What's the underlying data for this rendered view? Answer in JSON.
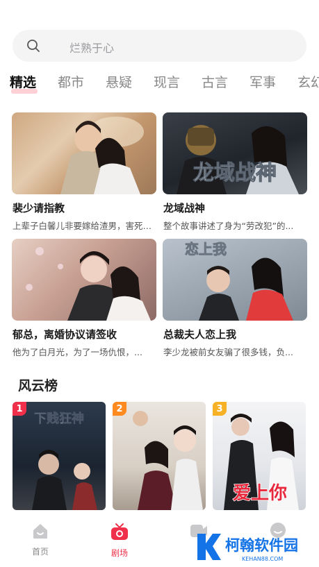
{
  "search": {
    "placeholder": "烂熟于心",
    "icon": "search-icon"
  },
  "tabs": [
    {
      "label": "精选",
      "active": true
    },
    {
      "label": "都市",
      "active": false
    },
    {
      "label": "悬疑",
      "active": false
    },
    {
      "label": "现言",
      "active": false
    },
    {
      "label": "古言",
      "active": false
    },
    {
      "label": "军事",
      "active": false
    },
    {
      "label": "玄幻",
      "active": false
    }
  ],
  "featured": [
    {
      "title": "裴少请指教",
      "desc": "上辈子白馨儿非要嫁给渣男，害死了..."
    },
    {
      "title": "龙域战神",
      "desc": "整个故事讲述了身为“劳改犯”的..."
    },
    {
      "title": "郁总，离婚协议请签收",
      "desc": "他为了白月光，为了一场仇恨，..."
    },
    {
      "title": "总裁夫人恋上我",
      "desc": "李少龙被前女友骗了很多钱，负..."
    }
  ],
  "thumb_texts": {
    "longyu": "龙域战神",
    "lianshang": "恋上我"
  },
  "ranking": {
    "title": "风云榜",
    "items": [
      {
        "rank": "1",
        "badge_color": "#f0304a",
        "poster_text": "下贱狂神"
      },
      {
        "rank": "2",
        "badge_color": "#ff8a1f",
        "poster_text": ""
      },
      {
        "rank": "3",
        "badge_color": "#f7b125",
        "poster_text": "爱上你"
      }
    ]
  },
  "tabbar": [
    {
      "label": "首页",
      "icon": "home-icon",
      "active": false
    },
    {
      "label": "剧场",
      "icon": "theater-icon",
      "active": true
    },
    {
      "label": "",
      "icon": "video-icon",
      "active": false
    },
    {
      "label": "",
      "icon": "profile-icon",
      "active": false
    }
  ],
  "watermark": {
    "brand": "柯翰软件园",
    "url": "KEHAN88.COM"
  },
  "colors": {
    "accent": "#f0304a",
    "search_bg": "#f4f4f5",
    "tab_underline": "#ffd0d6"
  }
}
